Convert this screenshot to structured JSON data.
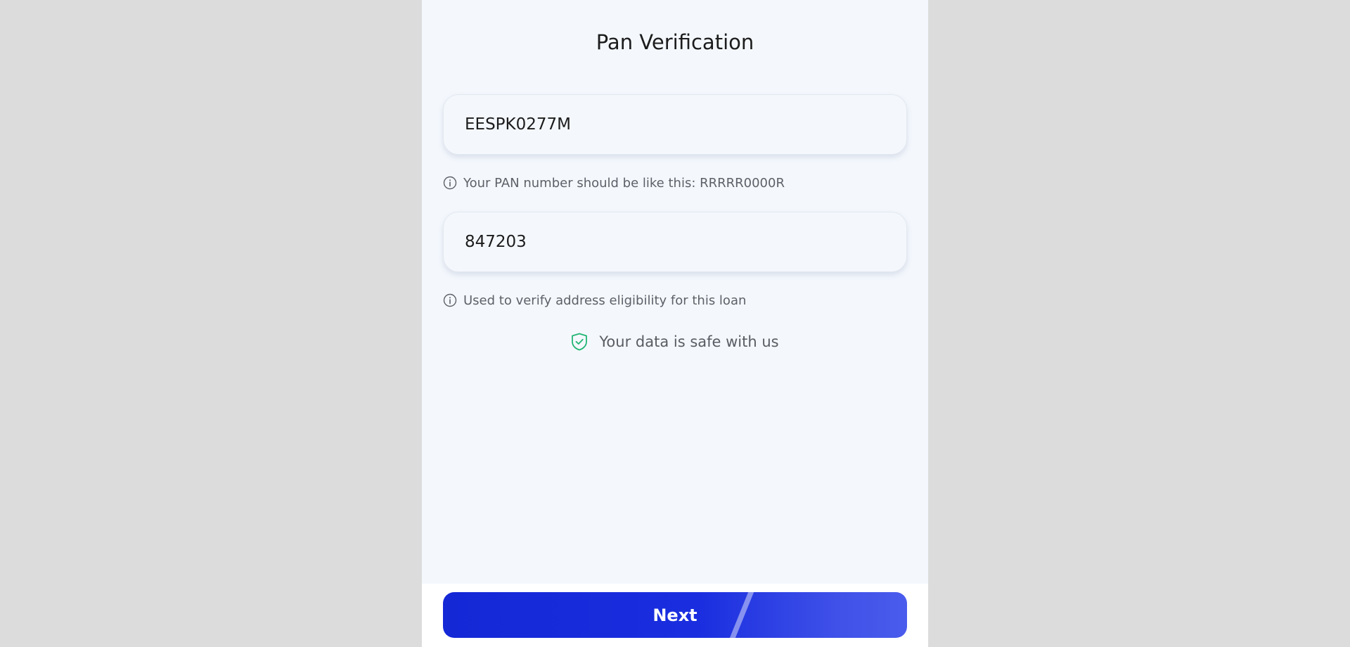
{
  "page": {
    "title": "Pan Verification"
  },
  "pan": {
    "value": "EESPK0277M",
    "hint": "Your PAN number should be like this: RRRRR0000R"
  },
  "pincode": {
    "value": "847203",
    "hint": "Used to verify address eligibility for this loan"
  },
  "safety": {
    "text": "Your data is safe with us",
    "icon": "shield-check-icon",
    "color": "#22b573"
  },
  "footer": {
    "next_label": "Next"
  },
  "colors": {
    "accent": "#1428d6",
    "background": "#f4f8fd"
  }
}
